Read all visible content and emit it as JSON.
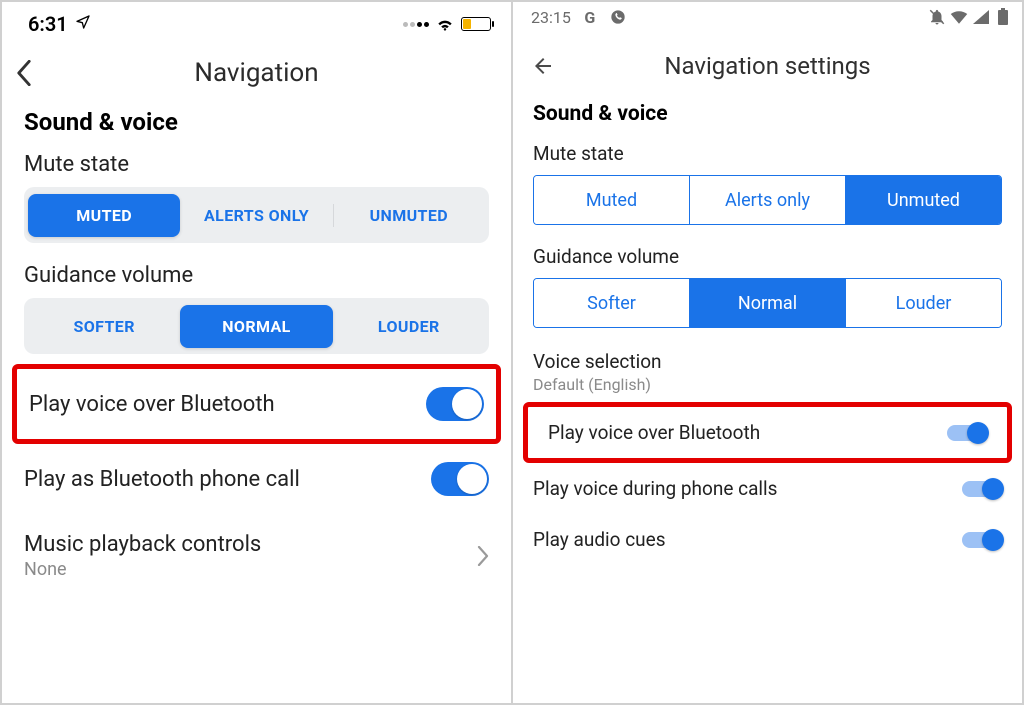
{
  "left": {
    "status": {
      "time": "6:31"
    },
    "header": {
      "title": "Navigation"
    },
    "section_sound_voice": "Sound & voice",
    "mute_state": {
      "label": "Mute state",
      "options": [
        "MUTED",
        "ALERTS ONLY",
        "UNMUTED"
      ],
      "selected": 0
    },
    "guidance_volume": {
      "label": "Guidance volume",
      "options": [
        "SOFTER",
        "NORMAL",
        "LOUDER"
      ],
      "selected": 1
    },
    "rows": {
      "voice_bt": "Play voice over Bluetooth",
      "bt_phone": "Play as Bluetooth phone call",
      "music_ctrls": "Music playback controls",
      "music_ctrls_sub": "None"
    }
  },
  "right": {
    "status": {
      "time": "23:15"
    },
    "header": {
      "title": "Navigation settings"
    },
    "section_sound_voice": "Sound & voice",
    "mute_state": {
      "label": "Mute state",
      "options": [
        "Muted",
        "Alerts only",
        "Unmuted"
      ],
      "selected": 2
    },
    "guidance_volume": {
      "label": "Guidance volume",
      "options": [
        "Softer",
        "Normal",
        "Louder"
      ],
      "selected": 1
    },
    "voice_selection": {
      "label": "Voice selection",
      "value": "Default (English)"
    },
    "rows": {
      "voice_bt": "Play voice over Bluetooth",
      "voice_calls": "Play voice during phone calls",
      "audio_cues": "Play audio cues"
    }
  }
}
